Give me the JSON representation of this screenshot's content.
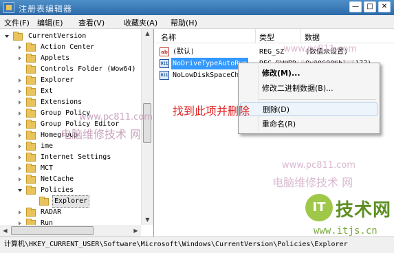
{
  "window": {
    "title": "注册表编辑器",
    "minimize_glyph": "—",
    "maximize_glyph": "□",
    "close_glyph": "✕"
  },
  "menu": [
    "文件(F)",
    "编辑(E)",
    "查看(V)",
    "收藏夹(A)",
    "帮助(H)"
  ],
  "tree": {
    "items": [
      {
        "label": "CurrentVersion",
        "expanded": true
      },
      {
        "label": "Action Center"
      },
      {
        "label": "Applets"
      },
      {
        "label": "Controls Folder (Wow64)"
      },
      {
        "label": "Explorer"
      },
      {
        "label": "Ext"
      },
      {
        "label": "Extensions"
      },
      {
        "label": "Group Policy"
      },
      {
        "label": "Group Policy Editor"
      },
      {
        "label": "Homegroup"
      },
      {
        "label": "ime"
      },
      {
        "label": "Internet Settings"
      },
      {
        "label": "MCT"
      },
      {
        "label": "NetCache"
      },
      {
        "label": "Policies",
        "expanded": true
      },
      {
        "label": "Explorer",
        "selected": true
      },
      {
        "label": "RADAR"
      },
      {
        "label": "Run"
      }
    ]
  },
  "list": {
    "columns": [
      "名称",
      "类型",
      "数据"
    ],
    "rows": [
      {
        "icon": "string-value-icon",
        "icon_text": "ab",
        "name": "(默认)",
        "type": "REG_SZ",
        "data": "(数值未设置)"
      },
      {
        "icon": "binary-value-icon",
        "icon_text": "011",
        "name": "NoDriveTypeAutoRun",
        "type": "REG_DWORD",
        "data": "0x000000b1 (177)",
        "selected": true
      },
      {
        "icon": "binary-value-icon",
        "icon_text": "011",
        "name": "NoLowDiskSpaceChecks",
        "type": "",
        "data": ""
      }
    ]
  },
  "context_menu": {
    "items": [
      {
        "label": "修改(M)...",
        "bold": true
      },
      {
        "label": "修改二进制数据(B)..."
      },
      {
        "label": "删除(D)",
        "highlighted": true
      },
      {
        "label": "重命名(R)"
      }
    ]
  },
  "annotation": "找到此项并删除",
  "statusbar": "计算机\\HKEY_CURRENT_USER\\Software\\Microsoft\\Windows\\CurrentVersion\\Policies\\Explorer",
  "watermarks": {
    "site": "www.pc811.com",
    "brand": "电脑维修技术 网",
    "logo_mark": "IT",
    "logo_text": "技术网",
    "logo_url": "www.itjs.cn"
  },
  "colors": {
    "title_bar": "#2c6aa8",
    "selection": "#3399ff",
    "annotation": "#e02020",
    "logo": "#5d8f22"
  }
}
